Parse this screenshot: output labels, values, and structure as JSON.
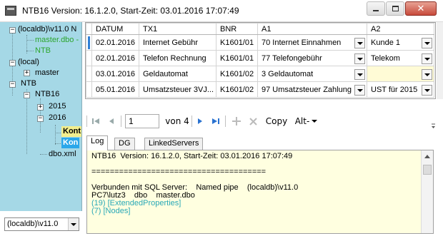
{
  "window": {
    "title": "NTB16  Version: 16.1.2.0, Start-Zeit: 03.01.2016 17:07:49",
    "close_glyph": "✕"
  },
  "tree": {
    "localdb": "(localdb)\\v11.0 N",
    "master_dbo": "master.dbo -",
    "ntb_green": "NTB",
    "local": "(local)",
    "master": "master",
    "ntb": "NTB",
    "ntb16": "NTB16",
    "y2015": "2015",
    "y2016": "2016",
    "konto1": "Kont",
    "konto2": "Kon",
    "dbo_xml": "dbo.xml"
  },
  "server_combo": {
    "value": "(localdb)\\v11.0"
  },
  "grid": {
    "columns": [
      "DATUM",
      "TX1",
      "BNR",
      "A1",
      "A2"
    ],
    "rows": [
      [
        "02.01.2016",
        "Internet Gebühr",
        "K1601/01",
        "70 Internet Einnahmen",
        "Kunde 1"
      ],
      [
        "02.01.2016",
        "Telefon Rechnung",
        "K1601/01",
        "77 Telefongebühr",
        "Telekom"
      ],
      [
        "03.01.2016",
        "Geldautomat",
        "K1601/02",
        "3 Geldautomat",
        ""
      ],
      [
        "05.01.2016",
        "Umsatzsteuer 3VJ...",
        "K1601/02",
        "97 Umsatzsteuer Zahlung",
        "UST für 2015"
      ]
    ]
  },
  "navigator": {
    "page": "1",
    "of_label": "von 4",
    "copy_label": "Copy",
    "alt_label": "Alt-"
  },
  "tabs": [
    "Log",
    "DG",
    "LinkedServers"
  ],
  "log": {
    "lines": [
      "NTB16  Version: 16.1.2.0, Start-Zeit: 03.01.2016 17:07:49",
      "",
      "======================================",
      "",
      "Verbunden mit SQL Server:    Named pipe    (localdb)\\v11.0",
      "PC7\\lutz3    dbo    master.dbo",
      "(19) [ExtendedProperties]",
      "(7) [Nodes]"
    ]
  },
  "colors": {
    "tree_bg": "#a5d8e6",
    "log_bg": "#ffffe0",
    "accent_teal": "#28a8b7",
    "selection_blue": "#2ba7ea",
    "selection_yellow": "#f2ee8e"
  }
}
